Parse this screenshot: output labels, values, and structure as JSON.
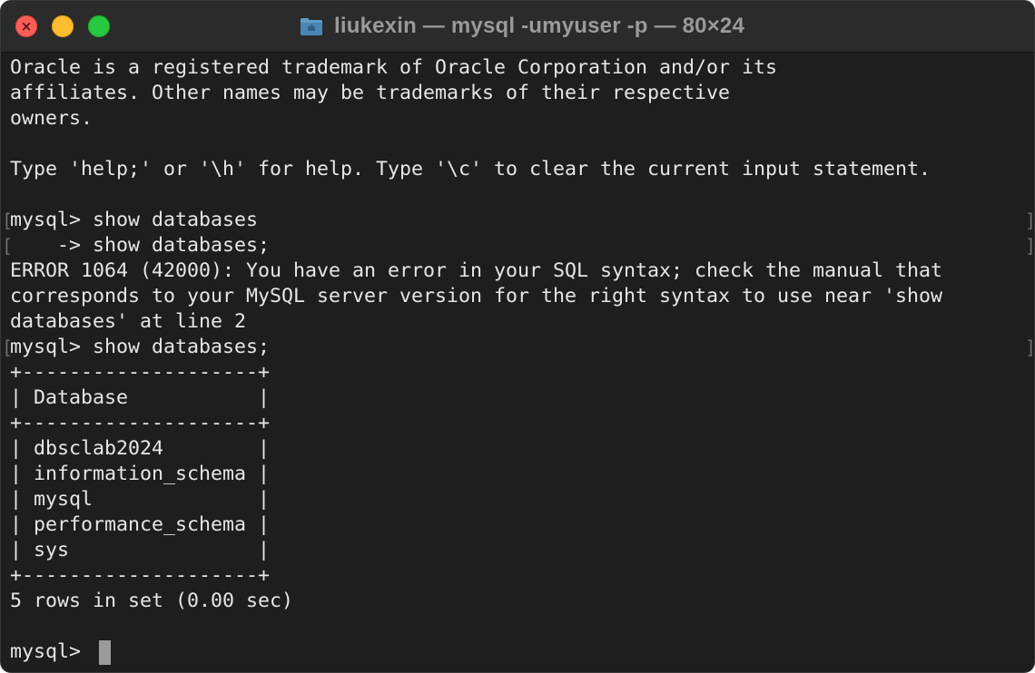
{
  "window": {
    "title": "liukexin — mysql -umyuser -p — 80×24",
    "title_icon": "folder-icon",
    "controls": {
      "close_icon": "close-icon",
      "minimize_icon": "minimize-icon",
      "zoom_icon": "zoom-icon"
    }
  },
  "terminal": {
    "lines": [
      "Oracle is a registered trademark of Oracle Corporation and/or its",
      "affiliates. Other names may be trademarks of their respective",
      "owners.",
      "",
      "Type 'help;' or '\\h' for help. Type '\\c' to clear the current input statement.",
      "",
      "mysql> show databases",
      "    -> show databases;",
      "ERROR 1064 (42000): You have an error in your SQL syntax; check the manual that",
      "corresponds to your MySQL server version for the right syntax to use near 'show",
      "databases' at line 2",
      "mysql> show databases;",
      "+--------------------+",
      "| Database           |",
      "+--------------------+",
      "| dbsclab2024        |",
      "| information_schema |",
      "| mysql              |",
      "| performance_schema |",
      "| sys                |",
      "+--------------------+",
      "5 rows in set (0.00 sec)",
      "",
      "mysql> "
    ],
    "selection_marks": {
      "left": "[",
      "right": "]"
    }
  },
  "colors": {
    "background": "#1e1e1e",
    "titlebar": "#2b2b2b",
    "text": "#e6e6e6",
    "close": "#ff5f57",
    "minimize": "#febc2e",
    "zoom": "#28c840",
    "cursor": "#9b9b9b"
  }
}
